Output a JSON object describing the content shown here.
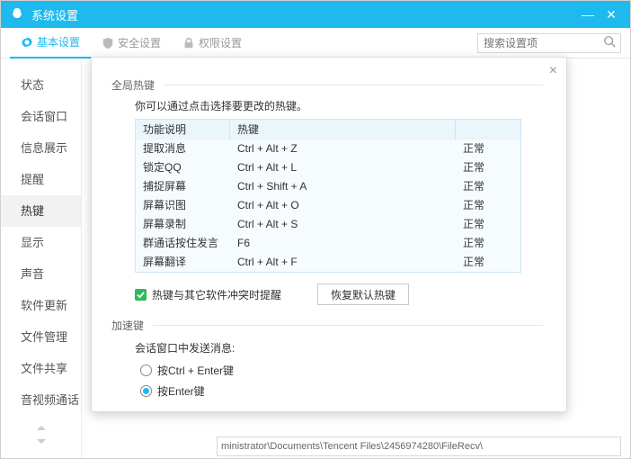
{
  "titlebar": {
    "title": "系统设置"
  },
  "toptabs": {
    "basic": "基本设置",
    "security": "安全设置",
    "privilege": "权限设置"
  },
  "search": {
    "placeholder": "搜索设置项"
  },
  "sidebar": {
    "items": [
      "状态",
      "会话窗口",
      "信息展示",
      "提醒",
      "热键",
      "显示",
      "声音",
      "软件更新",
      "文件管理",
      "文件共享",
      "音视频通话"
    ],
    "active_index": 4
  },
  "modal": {
    "global_section": "全局热键",
    "global_desc": "你可以通过点击选择要更改的热键。",
    "table_headers": {
      "func": "功能说明",
      "key": "热键",
      "stat": ""
    },
    "rows": [
      {
        "func": "提取消息",
        "key": "Ctrl + Alt + Z",
        "stat": "正常"
      },
      {
        "func": "锁定QQ",
        "key": "Ctrl + Alt + L",
        "stat": "正常"
      },
      {
        "func": "捕捉屏幕",
        "key": "Ctrl + Shift + A",
        "stat": "正常"
      },
      {
        "func": "屏幕识图",
        "key": "Ctrl + Alt + O",
        "stat": "正常"
      },
      {
        "func": "屏幕录制",
        "key": "Ctrl + Alt + S",
        "stat": "正常"
      },
      {
        "func": "群通话按住发言",
        "key": "F6",
        "stat": "正常"
      },
      {
        "func": "屏幕翻译",
        "key": "Ctrl + Alt + F",
        "stat": "正常"
      }
    ],
    "conflict_checkbox": "热键与其它软件冲突时提醒",
    "restore_btn": "恢复默认热键",
    "accel_section": "加速键",
    "accel_label": "会话窗口中发送消息:",
    "radio_ctrl_enter": "按Ctrl + Enter键",
    "radio_enter": "按Enter键",
    "radio_selected": "enter"
  },
  "pathbar": {
    "value": "ministrator\\Documents\\Tencent Files\\2456974280\\FileRecv\\"
  }
}
